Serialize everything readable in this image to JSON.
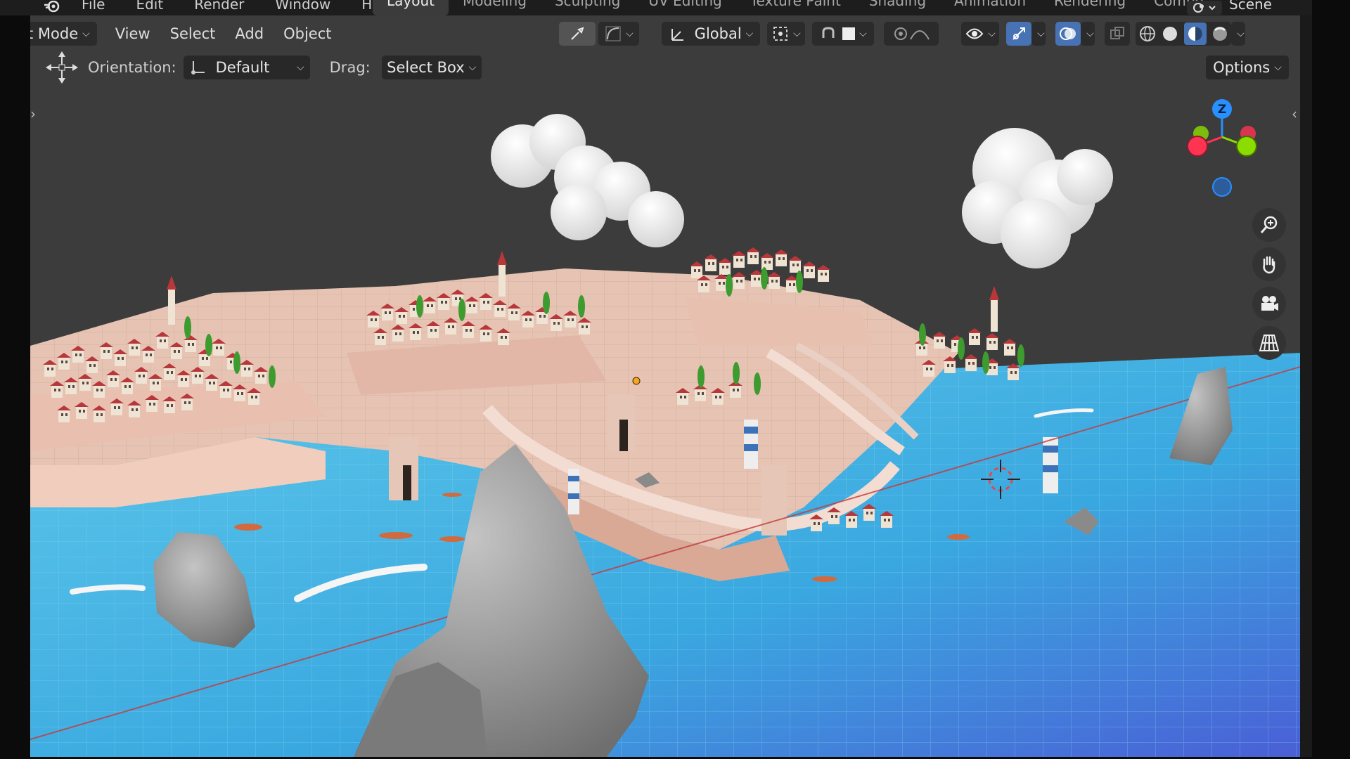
{
  "menubar": {
    "items": [
      "File",
      "Edit",
      "Render",
      "Window",
      "Help"
    ],
    "workspaces": [
      {
        "label": "Layout",
        "active": true
      },
      {
        "label": "Modeling",
        "active": false
      },
      {
        "label": "Sculpting",
        "active": false
      },
      {
        "label": "UV Editing",
        "active": false
      },
      {
        "label": "Texture Paint",
        "active": false
      },
      {
        "label": "Shading",
        "active": false
      },
      {
        "label": "Animation",
        "active": false
      },
      {
        "label": "Rendering",
        "active": false
      },
      {
        "label": "Compo",
        "active": false
      }
    ],
    "scene_label": "Scene"
  },
  "header": {
    "mode_label": "t Mode",
    "menus": [
      "View",
      "Select",
      "Add",
      "Object"
    ],
    "transform_orientation": "Global"
  },
  "tool_settings": {
    "orientation_label": "Orientation:",
    "orientation_value": "Default",
    "drag_label": "Drag:",
    "drag_value": "Select Box",
    "options_label": "Options"
  },
  "gizmo": {
    "z_label": "Z",
    "x_color": "#ff3352",
    "y_color": "#8bdc00",
    "z_color": "#2890ff"
  },
  "icons": [
    "blender-logo",
    "move-tool-icon",
    "orientation-icon",
    "transform-icon",
    "pivot-icon",
    "snap-icon",
    "proportional-edit-icon",
    "visibility-icon",
    "gizmo-icon",
    "overlay-icon",
    "xray-icon",
    "wireframe-shading-icon",
    "solid-shading-icon",
    "material-shading-icon",
    "rendered-shading-icon",
    "zoom-icon",
    "hand-icon",
    "camera-icon",
    "grid-icon"
  ],
  "colors": {
    "accent": "#4772b3",
    "water": "#46b8e0",
    "buildings": "#eee2d2",
    "roofs": "#b8373a",
    "trees": "#3e9b2f"
  }
}
